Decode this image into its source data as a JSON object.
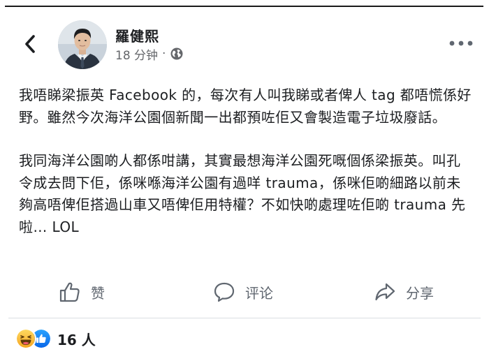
{
  "post": {
    "author": "羅健熙",
    "time": "18 分钟",
    "separator": "·",
    "paragraphs": [
      "我唔睇梁振英 Facebook 的，每次有人叫我睇或者俾人 tag 都唔慌係好野。雖然今次海洋公園個新聞一出都預咗佢又會製造電子垃圾廢話。",
      "我同海洋公園啲人都係咁講，其實最想海洋公園死嘅個係梁振英。叫孔令成去問下佢，係咪喺海洋公園有過咩 trauma，係咪佢啲細路以前未夠高唔俾佢搭過山車又唔俾佢用特權？不如快啲處理咗佢啲 trauma 先啦… LOL"
    ]
  },
  "actions": {
    "like": "赞",
    "comment": "评论",
    "share": "分享"
  },
  "reactions": {
    "count": "16 人"
  },
  "icons": {
    "back": "chevron-left-icon",
    "audience": "globe-icon",
    "more": "more-dots-icon",
    "like": "thumbs-up-icon",
    "comment": "comment-bubble-icon",
    "share": "share-arrow-icon",
    "haha": "haha-emoji-icon",
    "like_reaction": "like-reaction-icon"
  },
  "colors": {
    "text_primary": "#1c1e21",
    "text_secondary": "#65676b",
    "action_gray": "#606770",
    "like_blue": "#1877f2",
    "haha_yellow": "#f7b125"
  }
}
